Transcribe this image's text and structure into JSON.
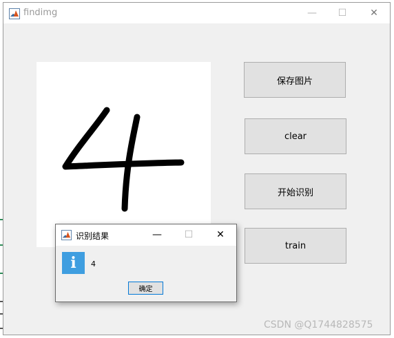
{
  "window": {
    "title": "findimg",
    "controls": {
      "minimize": "—",
      "maximize": "☐",
      "close": "✕"
    }
  },
  "canvas": {
    "drawn_digit": "4"
  },
  "buttons": {
    "save_image": "保存图片",
    "clear": "clear",
    "start_recognition": "开始识别",
    "train": "train"
  },
  "dialog": {
    "title": "识别结果",
    "message": "4",
    "ok_label": "确定",
    "icon": "info-icon",
    "controls": {
      "minimize": "—",
      "maximize": "☐",
      "close": "✕"
    }
  },
  "watermark": "CSDN @Q1744828575",
  "colors": {
    "info_icon": "#3f9ee0",
    "ok_border": "#0078d7",
    "window_bg": "#f0f0f0",
    "button_bg": "#e1e1e1"
  }
}
